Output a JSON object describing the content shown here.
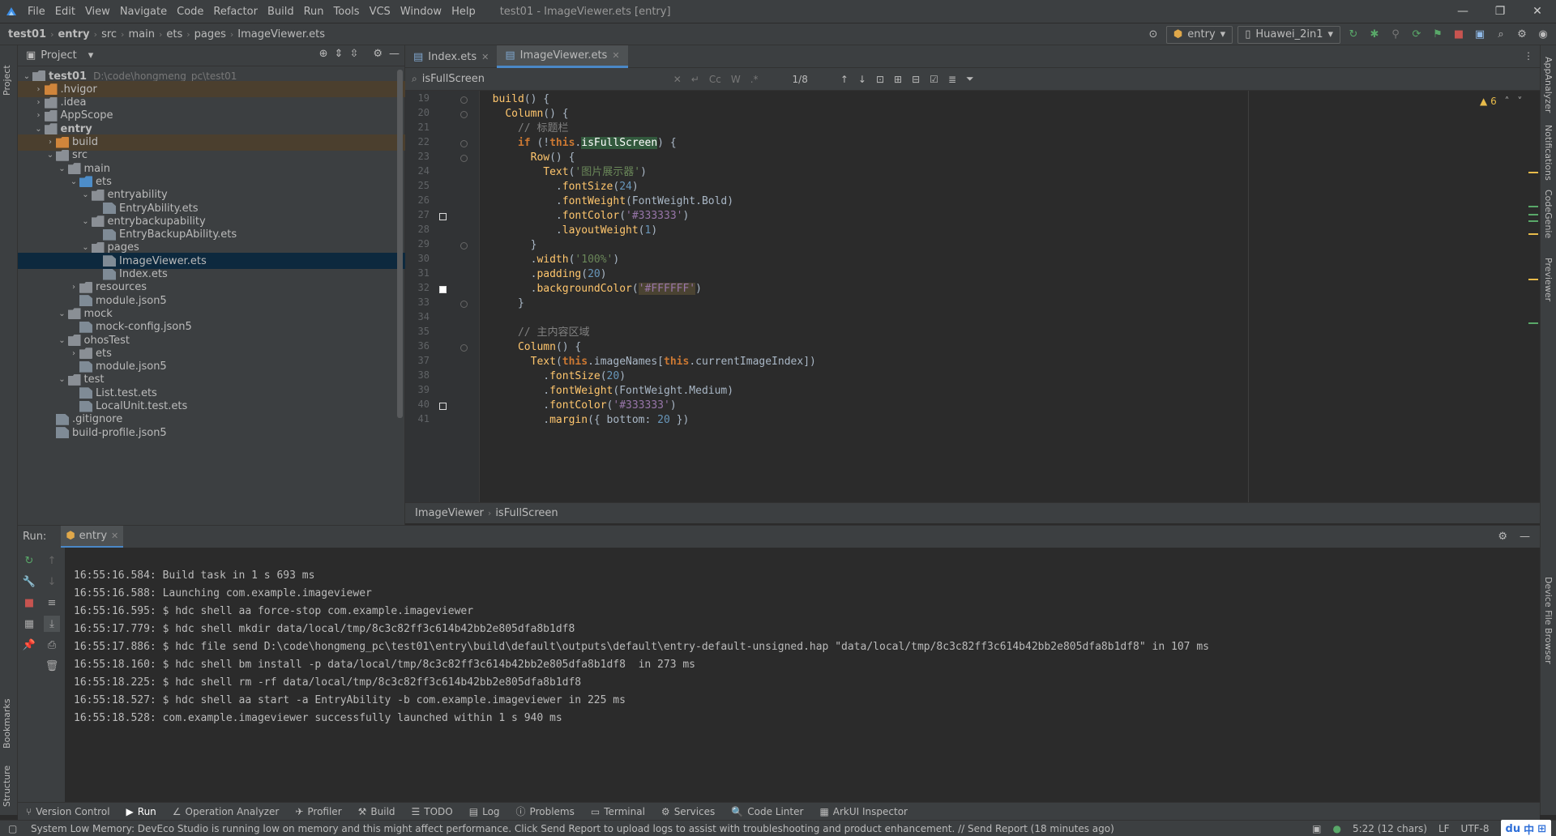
{
  "window": {
    "title": "test01 - ImageViewer.ets [entry]",
    "menu": [
      "File",
      "Edit",
      "View",
      "Navigate",
      "Code",
      "Refactor",
      "Build",
      "Run",
      "Tools",
      "VCS",
      "Window",
      "Help"
    ]
  },
  "navbar": {
    "crumbs": [
      "test01",
      "entry",
      "src",
      "main",
      "ets",
      "pages",
      "ImageViewer.ets"
    ],
    "run_config": "entry",
    "device": "Huawei_2in1"
  },
  "left_strip": {
    "top_tab": "Project",
    "bookmarks_tab": "Bookmarks",
    "structure_tab": "Structure"
  },
  "project": {
    "header": "Project",
    "tree": [
      {
        "label": "test01",
        "path": "D:\\code\\hongmeng_pc\\test01",
        "depth": 0,
        "arrow": "down",
        "icon": "folder",
        "bold": true
      },
      {
        "label": ".hvigor",
        "depth": 1,
        "arrow": "right",
        "icon": "folder-orange",
        "state": "excluded"
      },
      {
        "label": ".idea",
        "depth": 1,
        "arrow": "right",
        "icon": "folder"
      },
      {
        "label": "AppScope",
        "depth": 1,
        "arrow": "right",
        "icon": "folder"
      },
      {
        "label": "entry",
        "depth": 1,
        "arrow": "down",
        "icon": "folder",
        "bold": true
      },
      {
        "label": "build",
        "depth": 2,
        "arrow": "right",
        "icon": "folder-orange",
        "state": "excluded"
      },
      {
        "label": "src",
        "depth": 2,
        "arrow": "down",
        "icon": "folder"
      },
      {
        "label": "main",
        "depth": 3,
        "arrow": "down",
        "icon": "folder"
      },
      {
        "label": "ets",
        "depth": 4,
        "arrow": "down",
        "icon": "folder-blue"
      },
      {
        "label": "entryability",
        "depth": 5,
        "arrow": "down",
        "icon": "folder"
      },
      {
        "label": "EntryAbility.ets",
        "depth": 6,
        "arrow": "",
        "icon": "file"
      },
      {
        "label": "entrybackupability",
        "depth": 5,
        "arrow": "down",
        "icon": "folder"
      },
      {
        "label": "EntryBackupAbility.ets",
        "depth": 6,
        "arrow": "",
        "icon": "file"
      },
      {
        "label": "pages",
        "depth": 5,
        "arrow": "down",
        "icon": "folder"
      },
      {
        "label": "ImageViewer.ets",
        "depth": 6,
        "arrow": "",
        "icon": "file",
        "state": "selected"
      },
      {
        "label": "Index.ets",
        "depth": 6,
        "arrow": "",
        "icon": "file"
      },
      {
        "label": "resources",
        "depth": 4,
        "arrow": "right",
        "icon": "folder"
      },
      {
        "label": "module.json5",
        "depth": 4,
        "arrow": "",
        "icon": "file"
      },
      {
        "label": "mock",
        "depth": 3,
        "arrow": "down",
        "icon": "folder"
      },
      {
        "label": "mock-config.json5",
        "depth": 4,
        "arrow": "",
        "icon": "file"
      },
      {
        "label": "ohosTest",
        "depth": 3,
        "arrow": "down",
        "icon": "folder"
      },
      {
        "label": "ets",
        "depth": 4,
        "arrow": "right",
        "icon": "folder"
      },
      {
        "label": "module.json5",
        "depth": 4,
        "arrow": "",
        "icon": "file"
      },
      {
        "label": "test",
        "depth": 3,
        "arrow": "down",
        "icon": "folder"
      },
      {
        "label": "List.test.ets",
        "depth": 4,
        "arrow": "",
        "icon": "file"
      },
      {
        "label": "LocalUnit.test.ets",
        "depth": 4,
        "arrow": "",
        "icon": "file"
      },
      {
        "label": ".gitignore",
        "depth": 2,
        "arrow": "",
        "icon": "file"
      },
      {
        "label": "build-profile.json5",
        "depth": 2,
        "arrow": "",
        "icon": "file"
      }
    ]
  },
  "editor": {
    "tabs": [
      {
        "label": "Index.ets",
        "active": false
      },
      {
        "label": "ImageViewer.ets",
        "active": true
      }
    ],
    "search": {
      "query": "isFullScreen",
      "count": "1/8",
      "opt_case": "Cc",
      "opt_word": "W",
      "opt_regex": ".*"
    },
    "warnings": "6",
    "lines": [
      {
        "n": "19",
        "html": "  <span class='fn'>build</span>() {"
      },
      {
        "n": "20",
        "html": "    <span class='fn'>Column</span>() {"
      },
      {
        "n": "21",
        "html": "      <span class='comment'>// 标题栏</span>"
      },
      {
        "n": "22",
        "html": "      <span class='kw'>if</span> (!<span class='kw'>this</span>.<span class='hl'>isFullScreen</span>) {"
      },
      {
        "n": "23",
        "html": "        <span class='fn'>Row</span>() {"
      },
      {
        "n": "24",
        "html": "          <span class='fn'>Text</span>(<span class='str'>'图片展示器'</span>)"
      },
      {
        "n": "25",
        "html": "            .<span class='meth'>fontSize</span>(<span class='num'>24</span>)"
      },
      {
        "n": "26",
        "html": "            .<span class='meth'>fontWeight</span>(FontWeight.Bold)"
      },
      {
        "n": "27",
        "html": "            .<span class='meth'>fontColor</span>(<span class='strp'>'#333333'</span>)"
      },
      {
        "n": "28",
        "html": "            .<span class='meth'>layoutWeight</span>(<span class='num'>1</span>)"
      },
      {
        "n": "29",
        "html": "        }"
      },
      {
        "n": "30",
        "html": "        .<span class='meth'>width</span>(<span class='str'>'100%'</span>)"
      },
      {
        "n": "31",
        "html": "        .<span class='meth'>padding</span>(<span class='num'>20</span>)"
      },
      {
        "n": "32",
        "html": "        .<span class='meth'>backgroundColor</span>(<span class='hl2 strp'>'#FFFFFF'</span>)"
      },
      {
        "n": "33",
        "html": "      }"
      },
      {
        "n": "34",
        "html": ""
      },
      {
        "n": "35",
        "html": "      <span class='comment'>// 主内容区域</span>"
      },
      {
        "n": "36",
        "html": "      <span class='fn'>Column</span>() {"
      },
      {
        "n": "37",
        "html": "        <span class='fn'>Text</span>(<span class='kw'>this</span>.imageNames[<span class='kw'>this</span>.currentImageIndex])"
      },
      {
        "n": "38",
        "html": "          .<span class='meth'>fontSize</span>(<span class='num'>20</span>)"
      },
      {
        "n": "39",
        "html": "          .<span class='meth'>fontWeight</span>(FontWeight.Medium)"
      },
      {
        "n": "40",
        "html": "          .<span class='meth'>fontColor</span>(<span class='strp'>'#333333'</span>)"
      },
      {
        "n": "41",
        "html": "          .<span class='meth'>margin</span>({ bottom: <span class='num'>20</span> })"
      }
    ],
    "breakpoints": [
      "27",
      "32",
      "40"
    ],
    "folds": [
      "19",
      "20",
      "22",
      "23",
      "29",
      "33",
      "36"
    ],
    "breadcrumb": [
      "ImageViewer",
      "isFullScreen"
    ]
  },
  "run": {
    "label": "Run:",
    "tab": "entry",
    "console": [
      "16:55:16.584: Build task in 1 s 693 ms",
      "16:55:16.588: Launching com.example.imageviewer",
      "16:55:16.595: $ hdc shell aa force-stop com.example.imageviewer",
      "16:55:17.779: $ hdc shell mkdir data/local/tmp/8c3c82ff3c614b42bb2e805dfa8b1df8",
      "16:55:17.886: $ hdc file send D:\\code\\hongmeng_pc\\test01\\entry\\build\\default\\outputs\\default\\entry-default-unsigned.hap \"data/local/tmp/8c3c82ff3c614b42bb2e805dfa8b1df8\" in 107 ms",
      "16:55:18.160: $ hdc shell bm install -p data/local/tmp/8c3c82ff3c614b42bb2e805dfa8b1df8  in 273 ms",
      "16:55:18.225: $ hdc shell rm -rf data/local/tmp/8c3c82ff3c614b42bb2e805dfa8b1df8",
      "16:55:18.527: $ hdc shell aa start -a EntryAbility -b com.example.imageviewer in 225 ms",
      "16:55:18.528: com.example.imageviewer successfully launched within 1 s 940 ms"
    ]
  },
  "right_strip": [
    "AppAnalyzer",
    "Notifications",
    "CodeGenie",
    "Previewer",
    "Device File Browser"
  ],
  "bottom_tabs": [
    {
      "label": "Version Control",
      "icon": "⑂"
    },
    {
      "label": "Run",
      "icon": "▶",
      "active": true
    },
    {
      "label": "Operation Analyzer",
      "icon": "∠"
    },
    {
      "label": "Profiler",
      "icon": "✈"
    },
    {
      "label": "Build",
      "icon": "⚒"
    },
    {
      "label": "TODO",
      "icon": "☰"
    },
    {
      "label": "Log",
      "icon": "▤"
    },
    {
      "label": "Problems",
      "icon": "ⓘ"
    },
    {
      "label": "Terminal",
      "icon": "▭"
    },
    {
      "label": "Services",
      "icon": "⚙"
    },
    {
      "label": "Code Linter",
      "icon": "🔍"
    },
    {
      "label": "ArkUI Inspector",
      "icon": "▦"
    }
  ],
  "status": {
    "message": "System Low Memory: DevEco Studio is running low on memory and this might affect performance. Click Send Report to upload logs to assist with troubleshooting and product enhancement. // Send Report (18 minutes ago)",
    "position": "5:22 (12 chars)",
    "line_sep": "LF",
    "encoding": "UTF-8",
    "ime_lang": "中"
  },
  "colors": {
    "accent": "#4a88c7",
    "selection": "#0d293e",
    "excluded": "#4b3f2e",
    "search_hl": "#32593d"
  }
}
